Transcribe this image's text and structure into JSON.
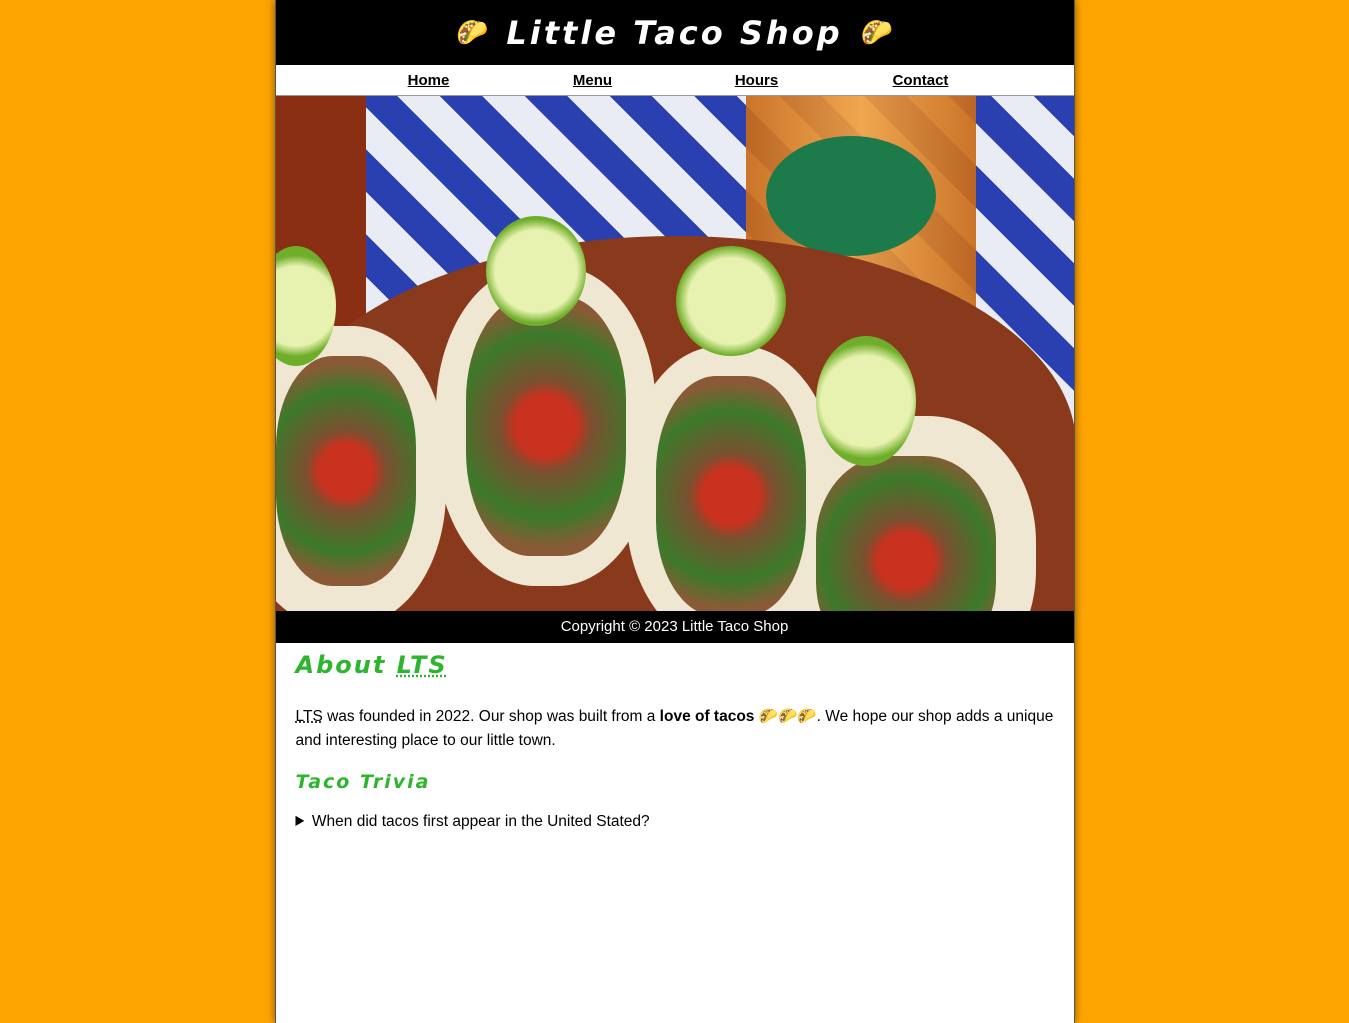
{
  "header": {
    "title": "Little Taco Shop",
    "emoji": "🌮"
  },
  "nav": {
    "items": [
      {
        "label": "Home"
      },
      {
        "label": "Menu"
      },
      {
        "label": "Hours"
      },
      {
        "label": "Contact"
      }
    ]
  },
  "hero": {
    "image": "tacos-photo"
  },
  "footer": {
    "copyright": "Copyright © 2023 Little Taco Shop"
  },
  "about": {
    "heading_prefix": "About ",
    "heading_abbr": "LTS",
    "para_abbr": "LTS",
    "para_text1": " was founded in 2022. Our shop was built from a ",
    "para_bold": "love of tacos",
    "para_emojis": " 🌮🌮🌮",
    "para_text2": ". We hope our shop adds a unique and interesting place to our little town."
  },
  "trivia": {
    "heading": "Taco Trivia",
    "question": "When did tacos first appear in the United Stated?"
  },
  "colors": {
    "background": "#FFA500",
    "heading": "#2db52d",
    "bar": "#000000"
  }
}
